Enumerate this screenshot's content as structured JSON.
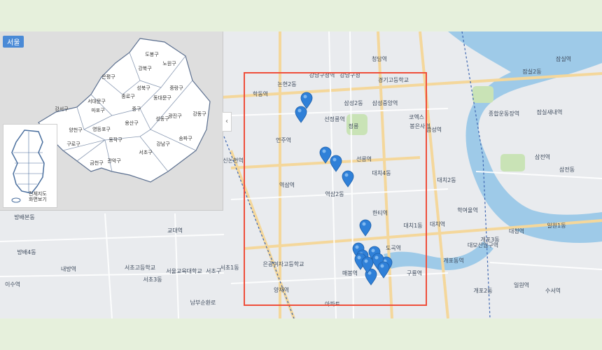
{
  "inset": {
    "region_tag": "서울",
    "districts": [
      "도봉구",
      "노원구",
      "강북구",
      "은평구",
      "성북구",
      "중랑구",
      "종로구",
      "동대문구",
      "서대문구",
      "마포구",
      "중구",
      "성동구",
      "광진구",
      "강동구",
      "강서구",
      "용산구",
      "양천구",
      "영등포구",
      "동작구",
      "구로구",
      "관악구",
      "금천구",
      "서초구",
      "강남구",
      "송파구"
    ],
    "full_map_line1": "전체지도",
    "full_map_line2": "화면보기",
    "collapse_glyph": "‹"
  },
  "map": {
    "labels": [
      "논현2동",
      "학동역",
      "강남구청역",
      "강남구청",
      "청담역",
      "삼성2동",
      "삼성중앙역",
      "경기고등학교",
      "언주역",
      "선정릉역",
      "정릉",
      "선릉역",
      "대치4동",
      "역삼역",
      "역삼2동",
      "한티역",
      "대치1동",
      "도곡역",
      "매봉역",
      "구룡역",
      "양재역",
      "서초구",
      "신논현역",
      "잠실2동",
      "종합운동장역",
      "잠실새내역",
      "삼성역",
      "코엑스",
      "대치2동",
      "삼전동",
      "학여울역",
      "대치역",
      "개포3동",
      "일원1동",
      "대청역",
      "개포동역",
      "개포2동",
      "일원역",
      "수서역",
      "방배본동",
      "방배4동",
      "내방역",
      "이수역",
      "서초1동",
      "서초3동",
      "교대역",
      "서초고등학교",
      "은광여자고등학교",
      "봉은사역",
      "삼전역",
      "잠실역",
      "대모산입구역",
      "서울교육대학교",
      "남부순환로",
      "아파트"
    ],
    "pin_count": 15
  }
}
